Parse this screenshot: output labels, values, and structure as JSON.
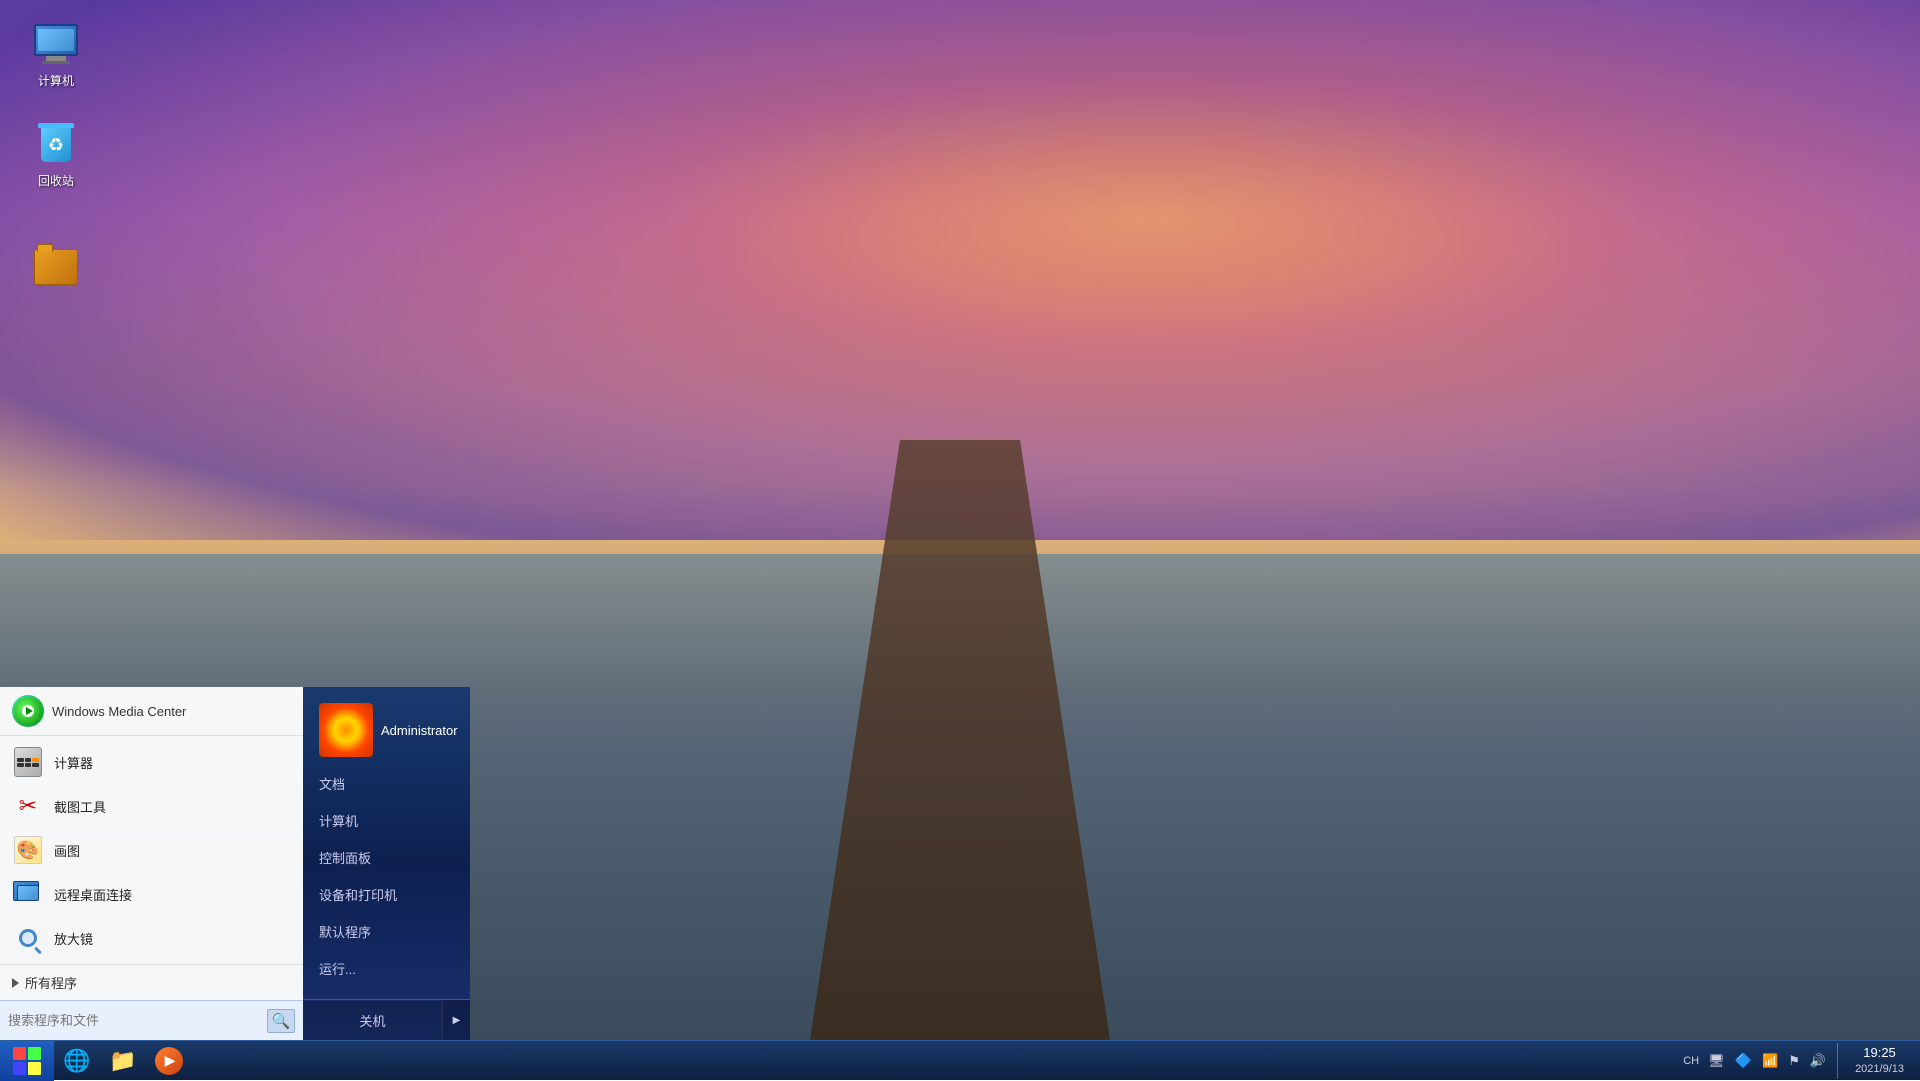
{
  "desktop": {
    "background_description": "sunset pier photo with purple sky and water",
    "icons": [
      {
        "id": "computer",
        "label": "计算机",
        "icon": "🖥️"
      },
      {
        "id": "recycle-bin",
        "label": "回收站",
        "icon": "♻️"
      }
    ]
  },
  "start_menu": {
    "pinned_app": {
      "name": "Windows Media Center",
      "icon_color": "#33cc44"
    },
    "app_list": [
      {
        "id": "calculator",
        "name": "计算器",
        "icon": "🧮"
      },
      {
        "id": "snipping-tool",
        "name": "截图工具",
        "icon": "✂️"
      },
      {
        "id": "paint",
        "name": "画图",
        "icon": "🎨"
      },
      {
        "id": "remote-desktop",
        "name": "远程桌面连接",
        "icon": "🖥️"
      },
      {
        "id": "magnifier",
        "name": "放大镜",
        "icon": "🔍"
      }
    ],
    "all_programs_label": "所有程序",
    "search_placeholder": "搜索程序和文件",
    "right_panel": {
      "username": "Administrator",
      "menu_items": [
        {
          "id": "documents",
          "label": "文档"
        },
        {
          "id": "computer",
          "label": "计算机"
        },
        {
          "id": "control-panel",
          "label": "控制面板"
        },
        {
          "id": "devices-printers",
          "label": "设备和打印机"
        },
        {
          "id": "default-programs",
          "label": "默认程序"
        },
        {
          "id": "run",
          "label": "运行..."
        }
      ],
      "shutdown_label": "关机"
    }
  },
  "taskbar": {
    "start_button_tooltip": "开始",
    "apps": [
      {
        "id": "ie",
        "icon": "🌐",
        "label": "Internet Explorer"
      },
      {
        "id": "file-explorer",
        "icon": "📁",
        "label": "文件资源管理器"
      },
      {
        "id": "media-player",
        "icon": "▶",
        "label": "Windows Media Player"
      }
    ],
    "system_tray": {
      "language": "CH",
      "icons": [
        "🖥",
        "🔷",
        "📶",
        "⊞",
        "🔊"
      ],
      "time": "19:25",
      "date": "2021/9/13"
    }
  }
}
